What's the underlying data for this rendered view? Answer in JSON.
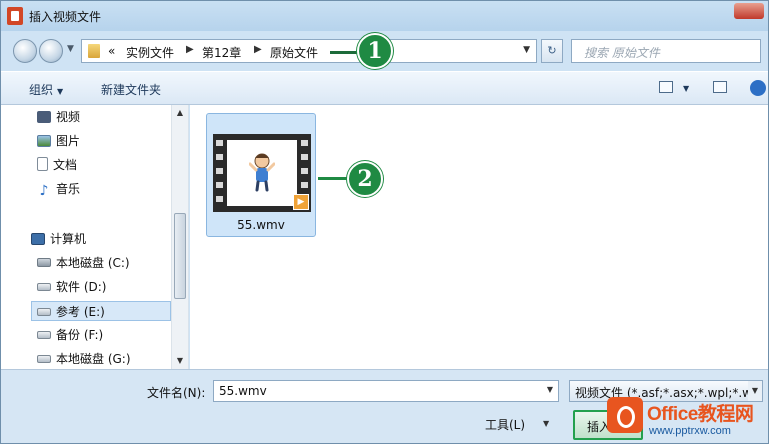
{
  "window": {
    "title": "插入视频文件"
  },
  "address_bar": {
    "overflow": "«",
    "breadcrumbs": [
      "实例文件",
      "第12章",
      "原始文件"
    ],
    "search_placeholder": "搜索 原始文件"
  },
  "callouts": [
    "1",
    "2"
  ],
  "toolbar": {
    "organize_label": "组织",
    "new_folder_label": "新建文件夹"
  },
  "sidebar": {
    "libraries": [
      {
        "label": "视频",
        "icon": "video-library-icon"
      },
      {
        "label": "图片",
        "icon": "picture-library-icon"
      },
      {
        "label": "文档",
        "icon": "document-library-icon"
      },
      {
        "label": "音乐",
        "icon": "music-library-icon"
      }
    ],
    "computer_label": "计算机",
    "drives": [
      {
        "label": "本地磁盘 (C:)",
        "icon": "local-disk-icon"
      },
      {
        "label": "软件 (D:)",
        "icon": "drive-icon"
      },
      {
        "label": "参考 (E:)",
        "icon": "drive-icon",
        "selected": true
      },
      {
        "label": "备份 (F:)",
        "icon": "drive-icon"
      },
      {
        "label": "本地磁盘 (G:)",
        "icon": "drive-icon"
      }
    ]
  },
  "files": [
    {
      "name": "55.wmv",
      "type": "video"
    }
  ],
  "bottom": {
    "filename_label": "文件名(N):",
    "filename_value": "55.wmv",
    "filter_value": "视频文件 (*.asf;*.asx;*.wpl;*.wi",
    "tools_label": "工具(L)",
    "insert_label": "插入"
  },
  "watermark": {
    "brand": "Office教程网",
    "url": "www.pptrxw.com"
  },
  "colors": {
    "callout_green": "#1f8a43",
    "selection_blue": "#cfe5f9",
    "brand_orange": "#e8551f"
  }
}
